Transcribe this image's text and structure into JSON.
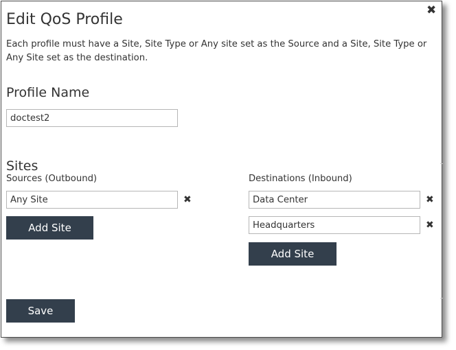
{
  "dialog": {
    "title": "Edit QoS Profile",
    "close_icon": "close-icon",
    "description": "Each profile must have a Site, Site Type or Any site set as the Source and a Site, Site Type or Any Site set as the destination."
  },
  "profile_name": {
    "heading": "Profile Name",
    "value": "doctest2"
  },
  "sites": {
    "heading": "Sites",
    "sources": {
      "label": "Sources (Outbound)",
      "items": [
        {
          "value": "Any Site",
          "remove_icon": "remove-icon"
        }
      ],
      "add_label": "Add Site"
    },
    "destinations": {
      "label": "Destinations (Inbound)",
      "items": [
        {
          "value": "Data Center",
          "remove_icon": "remove-icon"
        },
        {
          "value": "Headquarters",
          "remove_icon": "remove-icon"
        }
      ],
      "add_label": "Add Site"
    }
  },
  "actions": {
    "save_label": "Save"
  },
  "colors": {
    "button_bg": "#333f4c",
    "button_text": "#ffffff",
    "text": "#333333",
    "input_border": "#b5b5b5"
  }
}
